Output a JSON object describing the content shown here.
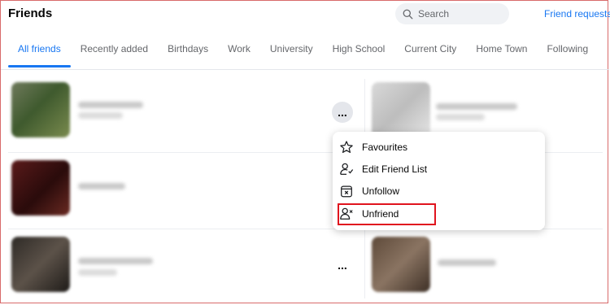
{
  "header": {
    "title": "Friends",
    "search_placeholder": "Search",
    "friend_requests_label": "Friend requests"
  },
  "tabs": [
    {
      "label": "All friends",
      "active": true
    },
    {
      "label": "Recently added",
      "active": false
    },
    {
      "label": "Birthdays",
      "active": false
    },
    {
      "label": "Work",
      "active": false
    },
    {
      "label": "University",
      "active": false
    },
    {
      "label": "High School",
      "active": false
    },
    {
      "label": "Current City",
      "active": false
    },
    {
      "label": "Home Town",
      "active": false
    },
    {
      "label": "Following",
      "active": false
    }
  ],
  "friend_card": {
    "more_options_label": "..."
  },
  "menu": {
    "items": [
      {
        "label": "Favourites",
        "icon": "star-icon"
      },
      {
        "label": "Edit Friend List",
        "icon": "edit-person-icon"
      },
      {
        "label": "Unfollow",
        "icon": "unfollow-icon"
      },
      {
        "label": "Unfriend",
        "icon": "remove-person-icon"
      }
    ]
  },
  "colors": {
    "accent": "#1877f2",
    "highlight": "#e0141e"
  }
}
